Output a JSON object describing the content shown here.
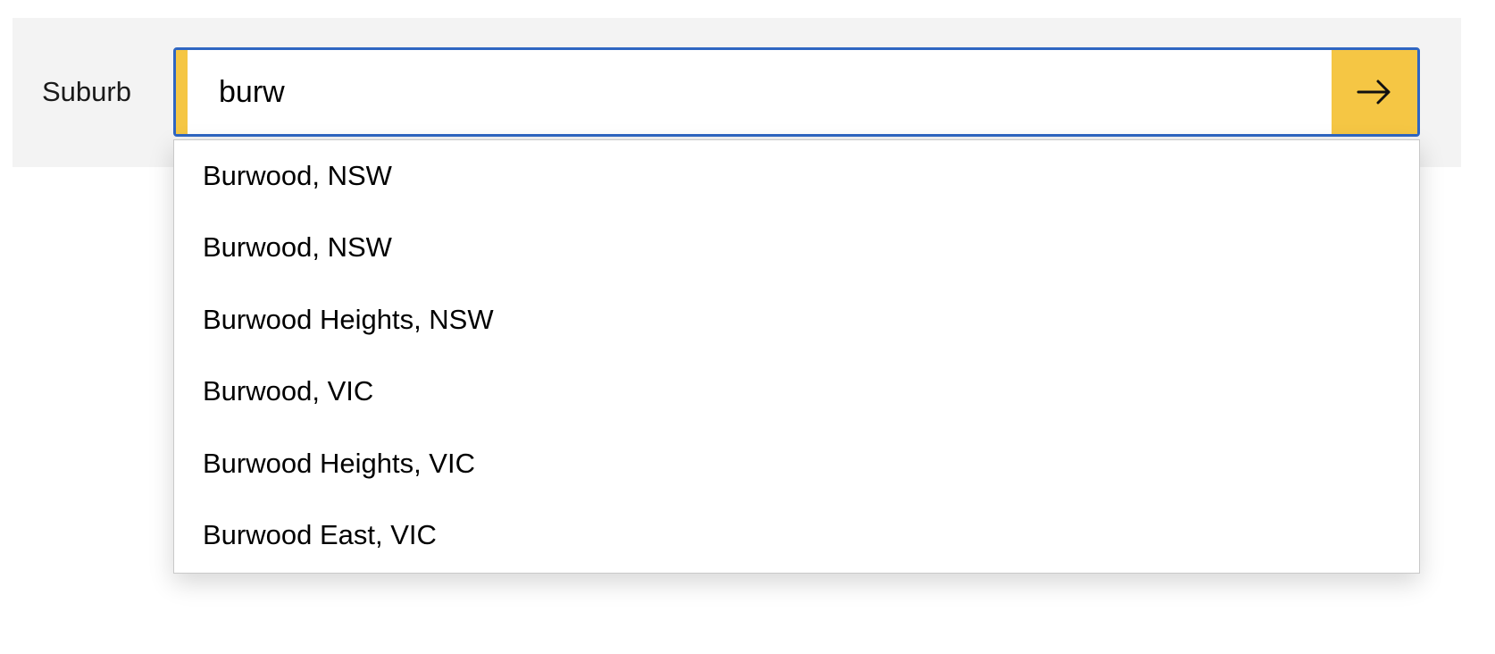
{
  "form": {
    "label": "Suburb",
    "input_value": "burw",
    "submit_icon": "arrow-right-icon",
    "accent_color": "#f5c644",
    "focus_border_color": "#2f66c2"
  },
  "suggestions": [
    {
      "label": "Burwood, NSW"
    },
    {
      "label": "Burwood, NSW"
    },
    {
      "label": "Burwood Heights, NSW"
    },
    {
      "label": "Burwood, VIC"
    },
    {
      "label": "Burwood Heights, VIC"
    },
    {
      "label": "Burwood East, VIC"
    }
  ]
}
